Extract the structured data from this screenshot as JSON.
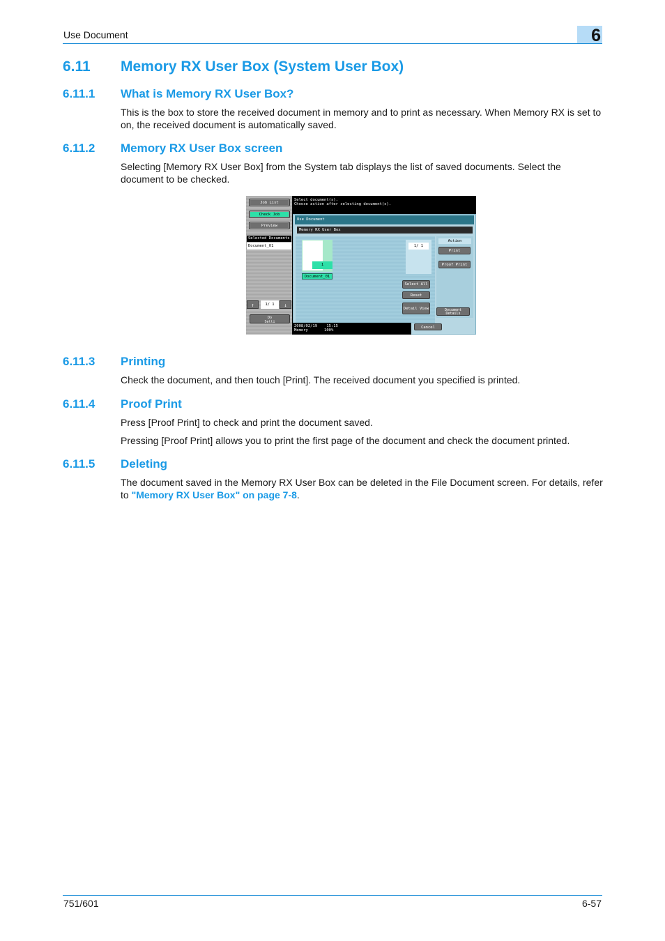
{
  "header": {
    "section_title": "Use Document",
    "chapter_number": "6"
  },
  "main_heading": {
    "number": "6.11",
    "title": "Memory RX User Box (System User Box)"
  },
  "sections": [
    {
      "number": "6.11.1",
      "title": "What is Memory RX User Box?",
      "paragraphs": [
        "This is the box to store the received document in memory and to print as necessary. When Memory RX is set to on, the received document is automatically saved."
      ]
    },
    {
      "number": "6.11.2",
      "title": "Memory RX User Box screen",
      "paragraphs": [
        "Selecting [Memory RX User Box] from the System tab displays the list of saved documents. Select the document to be checked."
      ]
    },
    {
      "number": "6.11.3",
      "title": "Printing",
      "paragraphs": [
        "Check the document, and then touch [Print]. The received document you specified is printed."
      ]
    },
    {
      "number": "6.11.4",
      "title": "Proof Print",
      "paragraphs": [
        "Press [Proof Print] to check and print the document saved.",
        "Pressing [Proof Print] allows you to print the first page of the document and check the document printed."
      ]
    },
    {
      "number": "6.11.5",
      "title": "Deleting",
      "paragraphs": [
        "The document saved in the Memory RX User Box can be deleted in the File Document screen. For details, refer to "
      ],
      "link_text": "\"Memory RX User Box\" on page 7-8",
      "trailing_text": "."
    }
  ],
  "screen": {
    "left_panel": {
      "buttons": [
        "Job List",
        "Check Job",
        "Preview"
      ],
      "active_button": "Check Job",
      "selected_header": "Selected Documents",
      "selected_items": [
        "Document_01"
      ],
      "pager_value": "1/  1",
      "up_arrow": "↑",
      "down_arrow": "↓",
      "back_button": "Do\nSetti"
    },
    "message": "Select document(s).\nChoose action after selecting document(s).",
    "title": "Use Document",
    "subtitle": "Memory RX User Box",
    "document": {
      "name": "Document_01",
      "page_count": "1"
    },
    "page_indicator": "1/  1",
    "side_buttons": [
      "Select All",
      "Reset",
      "Detail View"
    ],
    "action_header": "Action",
    "action_buttons": [
      "Print",
      "Proof Print"
    ],
    "document_details_button": "Document Details",
    "cancel_button": "Cancel",
    "status": "2008/02/19    15:15\nMemory       100%"
  },
  "footer": {
    "model": "751/601",
    "page": "6-57"
  },
  "colors": {
    "accent": "#1a9ae6",
    "rule": "#1f8fd8",
    "chapter_box": "#b6dcf7",
    "active_button": "#2de0a8"
  }
}
